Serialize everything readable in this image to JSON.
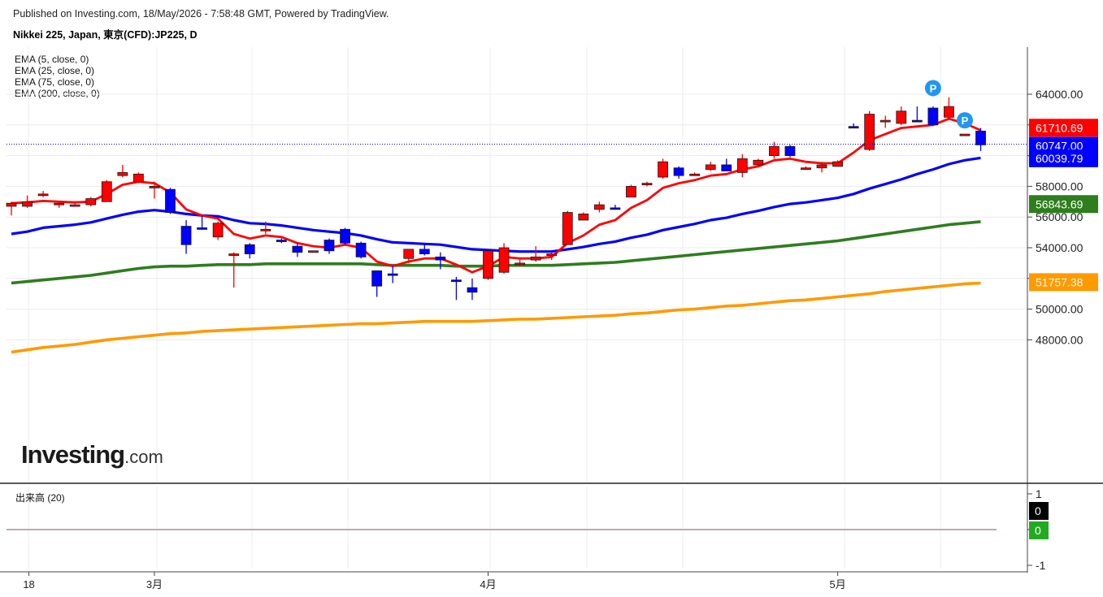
{
  "header": {
    "published": "Published on Investing.com, 18/May/2026 - 7:58:48 GMT, Powered by TradingView.",
    "instrument": "Nikkei 225, Japan, 東京(CFD):JP225, D"
  },
  "indicators": [
    "EMA (5, close, 0)",
    "EMA (25, close, 0)",
    "EMA (75, close, 0)",
    "EMA (200, close, 0)"
  ],
  "volume_panel": {
    "label": "出来高 (20)",
    "ticks": [
      "1",
      "0",
      "-1"
    ],
    "badges": [
      {
        "text": "0",
        "color": "#000000"
      },
      {
        "text": "0",
        "color": "#22aa22"
      }
    ]
  },
  "logo": {
    "main": "Investing",
    "suffix": ".com"
  },
  "colors": {
    "up": "#ff0000",
    "down": "#0000ff",
    "ema5": "#ff0000",
    "ema25": "#0000ff",
    "ema75": "#2e7d1e",
    "ema200": "#ff9a00",
    "grid": "#ececec"
  },
  "chart_data": {
    "type": "candlestick",
    "title": "Nikkei 225, Japan, 東京(CFD):JP225, D",
    "y_ticks": [
      48000,
      50000,
      52000,
      54000,
      56000,
      58000,
      60000,
      62000,
      64000
    ],
    "y_tick_labels": [
      "48000.00",
      "50000.00",
      "52000.00",
      "54000.00",
      "56000.00",
      "58000.00",
      "60000.00",
      "62000.00",
      "64000.00"
    ],
    "ylim": [
      46000,
      65000
    ],
    "x_labels": [
      {
        "index": 1,
        "label": "18"
      },
      {
        "index": 9,
        "label": "3月"
      },
      {
        "index": 30,
        "label": "4月"
      },
      {
        "index": 52,
        "label": "5月"
      }
    ],
    "last_price_line": 60747.0,
    "price_tags": [
      {
        "value": 61710.69,
        "text": "61710.69",
        "color": "#ff0000"
      },
      {
        "value": 60747.0,
        "text": "60747.00",
        "color": "#0000ff"
      },
      {
        "value": 60039.79,
        "text": "60039.79",
        "color": "#0000ff"
      },
      {
        "value": 56843.69,
        "text": "56843.69",
        "color": "#2e7d1e"
      },
      {
        "value": 51757.38,
        "text": "51757.38",
        "color": "#ff9a00"
      }
    ],
    "markers": [
      {
        "index": 58,
        "label": "P",
        "value": 64400
      },
      {
        "index": 60,
        "label": "P",
        "value": 62300
      }
    ],
    "candles": [
      [
        56700,
        57000,
        56100,
        56900
      ],
      [
        56700,
        57400,
        56600,
        57000
      ],
      [
        57400,
        57700,
        57300,
        57500
      ],
      [
        56800,
        57000,
        56600,
        56900
      ],
      [
        56800,
        56900,
        56700,
        56800
      ],
      [
        56800,
        57300,
        56700,
        57200
      ],
      [
        57000,
        58400,
        57000,
        58300
      ],
      [
        58700,
        59400,
        58600,
        58900
      ],
      [
        58300,
        58900,
        58200,
        58800
      ],
      [
        58000,
        58300,
        57200,
        58000
      ],
      [
        57800,
        57900,
        56200,
        56300
      ],
      [
        55400,
        55800,
        53600,
        54200
      ],
      [
        55300,
        56100,
        55200,
        55200
      ],
      [
        54700,
        55700,
        54500,
        55600
      ],
      [
        53600,
        53700,
        51400,
        53600
      ],
      [
        54200,
        54300,
        53300,
        53600
      ],
      [
        55100,
        55700,
        54900,
        55200
      ],
      [
        54500,
        54600,
        54300,
        54400
      ],
      [
        54100,
        54300,
        53400,
        53700
      ],
      [
        53700,
        53800,
        53700,
        53800
      ],
      [
        54500,
        54600,
        53600,
        53800
      ],
      [
        55200,
        55300,
        54200,
        54300
      ],
      [
        54300,
        54400,
        53300,
        53400
      ],
      [
        52500,
        52500,
        50800,
        51500
      ],
      [
        52300,
        52800,
        51700,
        52200
      ],
      [
        53300,
        53900,
        53000,
        53900
      ],
      [
        53900,
        54200,
        53500,
        53600
      ],
      [
        53400,
        53700,
        52600,
        53200
      ],
      [
        51900,
        52100,
        50600,
        51800
      ],
      [
        51400,
        52000,
        50600,
        51100
      ],
      [
        52000,
        53800,
        51900,
        53800
      ],
      [
        52400,
        54300,
        52300,
        54000
      ],
      [
        52900,
        53300,
        52800,
        53000
      ],
      [
        53200,
        54100,
        53100,
        53400
      ],
      [
        53500,
        53700,
        53200,
        53600
      ],
      [
        54200,
        56400,
        54200,
        56300
      ],
      [
        55800,
        56300,
        55800,
        56200
      ],
      [
        56500,
        57000,
        56300,
        56800
      ],
      [
        56600,
        56800,
        56500,
        56500
      ],
      [
        57300,
        58100,
        57300,
        58000
      ],
      [
        58100,
        58300,
        58000,
        58200
      ],
      [
        58600,
        59800,
        58500,
        59600
      ],
      [
        59200,
        59300,
        58500,
        58700
      ],
      [
        58800,
        58900,
        58800,
        58800
      ],
      [
        59100,
        59600,
        59000,
        59400
      ],
      [
        59400,
        59800,
        59300,
        59000
      ],
      [
        58900,
        60100,
        58600,
        59800
      ],
      [
        59400,
        59800,
        59300,
        59700
      ],
      [
        60000,
        60900,
        59800,
        60600
      ],
      [
        60600,
        60700,
        59900,
        60000
      ],
      [
        59200,
        59300,
        59100,
        59200
      ],
      [
        59200,
        59600,
        58900,
        59400
      ],
      [
        59300,
        59700,
        59300,
        59600
      ],
      [
        61900,
        62100,
        61800,
        61800
      ],
      [
        60400,
        62900,
        60300,
        62700
      ],
      [
        62200,
        62600,
        61800,
        62300
      ],
      [
        62100,
        63200,
        62000,
        62900
      ],
      [
        62300,
        63200,
        62200,
        62200
      ],
      [
        63100,
        63200,
        62000,
        62000
      ],
      [
        62500,
        63800,
        62400,
        63200
      ],
      [
        61400,
        61400,
        61400,
        61400
      ],
      [
        61600,
        61800,
        60300,
        60700
      ]
    ],
    "series": [
      {
        "name": "EMA (5, close, 0)",
        "color": "#ff0000",
        "values": [
          56900,
          56950,
          57050,
          57000,
          56950,
          57000,
          57500,
          58100,
          58300,
          58200,
          57600,
          56500,
          56100,
          55900,
          54900,
          54600,
          54800,
          54700,
          54300,
          54100,
          54000,
          54200,
          54000,
          53100,
          52800,
          53100,
          53300,
          53300,
          52900,
          52400,
          52800,
          53400,
          53300,
          53300,
          53400,
          54300,
          54800,
          55500,
          55800,
          56600,
          57100,
          57900,
          58200,
          58400,
          58700,
          58800,
          59100,
          59300,
          59700,
          59800,
          59600,
          59500,
          59500,
          60200,
          61000,
          61400,
          61800,
          61900,
          62000,
          62400,
          62100,
          61650
        ]
      },
      {
        "name": "EMA (25, close, 0)",
        "color": "#0000ff",
        "values": [
          54900,
          55050,
          55300,
          55400,
          55500,
          55650,
          55900,
          56150,
          56350,
          56450,
          56350,
          56200,
          56100,
          56050,
          55800,
          55600,
          55550,
          55450,
          55300,
          55150,
          55050,
          54950,
          54800,
          54550,
          54350,
          54300,
          54250,
          54200,
          54050,
          53900,
          53850,
          53800,
          53750,
          53750,
          53750,
          53900,
          54050,
          54250,
          54400,
          54650,
          54850,
          55150,
          55350,
          55550,
          55800,
          55950,
          56200,
          56400,
          56650,
          56850,
          56950,
          57100,
          57250,
          57500,
          57850,
          58150,
          58450,
          58800,
          59100,
          59450,
          59700,
          59850
        ]
      },
      {
        "name": "EMA (75, close, 0)",
        "color": "#2e7d1e",
        "values": [
          51700,
          51800,
          51900,
          52000,
          52100,
          52200,
          52350,
          52500,
          52650,
          52750,
          52800,
          52800,
          52850,
          52900,
          52900,
          52900,
          52950,
          52950,
          52950,
          52950,
          52950,
          52950,
          52950,
          52900,
          52850,
          52850,
          52850,
          52850,
          52800,
          52800,
          52800,
          52850,
          52850,
          52850,
          52850,
          52900,
          52950,
          53000,
          53050,
          53150,
          53250,
          53350,
          53450,
          53550,
          53650,
          53750,
          53850,
          53950,
          54050,
          54150,
          54250,
          54350,
          54450,
          54600,
          54750,
          54900,
          55050,
          55200,
          55350,
          55500,
          55600,
          55700
        ]
      },
      {
        "name": "EMA (200, close, 0)",
        "color": "#ff9a00",
        "values": [
          47200,
          47350,
          47500,
          47600,
          47700,
          47850,
          48000,
          48100,
          48200,
          48300,
          48400,
          48450,
          48550,
          48600,
          48650,
          48700,
          48750,
          48800,
          48850,
          48900,
          48950,
          49000,
          49050,
          49050,
          49100,
          49150,
          49200,
          49200,
          49200,
          49200,
          49250,
          49300,
          49350,
          49350,
          49400,
          49450,
          49500,
          49550,
          49600,
          49700,
          49750,
          49850,
          49950,
          50000,
          50100,
          50200,
          50250,
          50350,
          50450,
          50550,
          50600,
          50700,
          50800,
          50900,
          51000,
          51150,
          51250,
          51350,
          51450,
          51550,
          51650,
          51700
        ]
      }
    ]
  }
}
